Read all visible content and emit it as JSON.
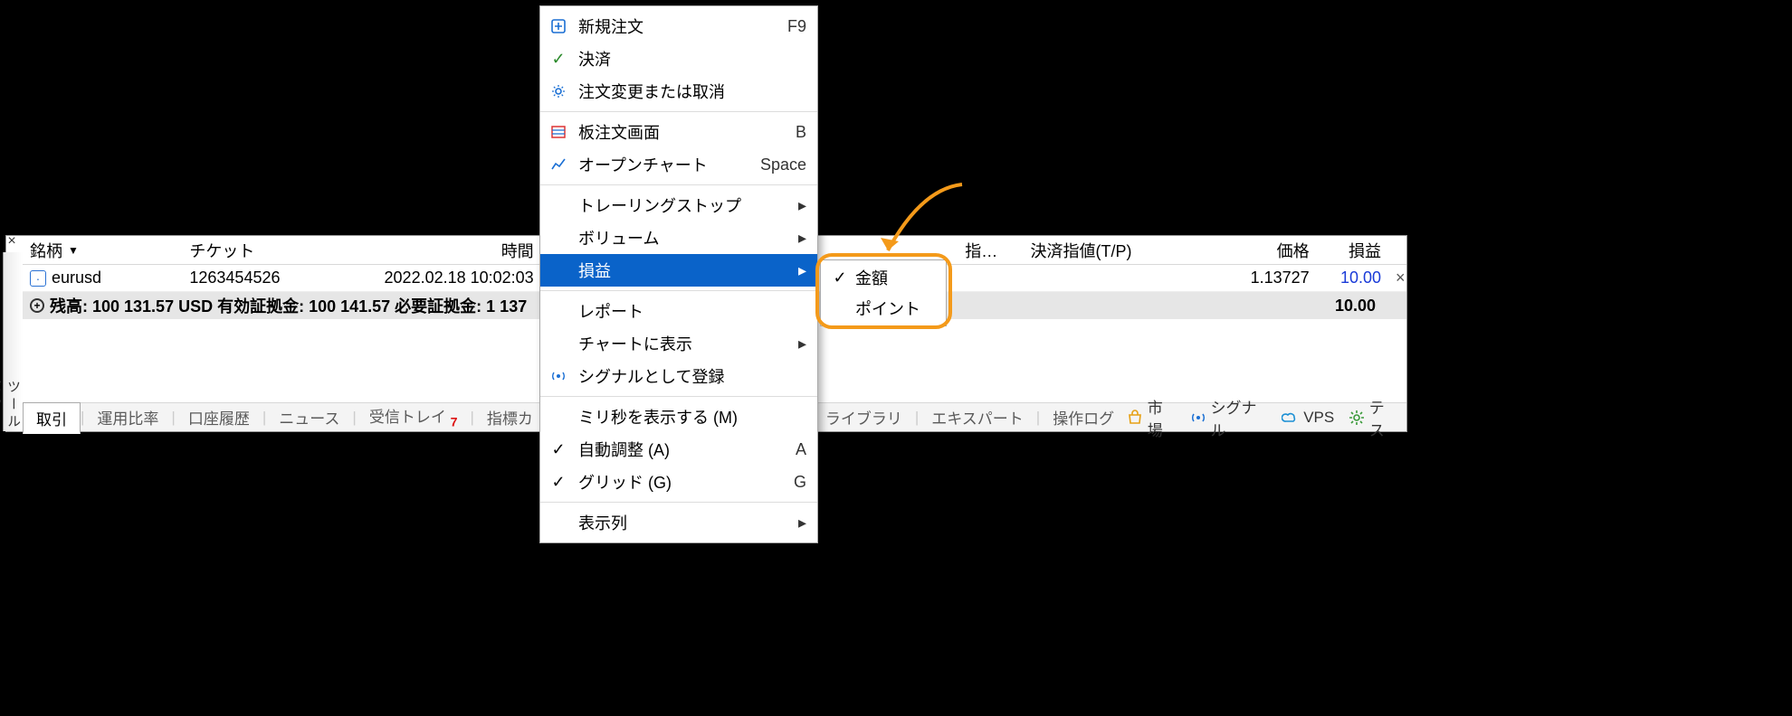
{
  "panel_title": "ツールボックス",
  "headers": {
    "symbol": "銘柄",
    "ticket": "チケット",
    "time": "時間",
    "sl_suffix": "指値(...",
    "tp": "決済指値(T/P)",
    "price": "価格",
    "pl": "損益"
  },
  "row": {
    "symbol": "eurusd",
    "ticket": "1263454526",
    "time": "2022.02.18 10:02:03",
    "price": "1.13727",
    "pl": "10.00"
  },
  "summary": {
    "text": "残高: 100 131.57 USD  有効証拠金: 100 141.57  必要証拠金: 1 137",
    "pl": "10.00"
  },
  "tabs": {
    "trade": "取引",
    "exposure": "運用比率",
    "history": "口座履歴",
    "news": "ニュース",
    "mailbox": "受信トレイ",
    "mailbox_badge": "7",
    "calendar": "指標カ",
    "library": "ライブラリ",
    "experts": "エキスパート",
    "journal": "操作ログ"
  },
  "services": {
    "market": "市場",
    "signals": "シグナル",
    "vps": "VPS",
    "tester": "テス"
  },
  "menu": {
    "new_order": {
      "label": "新規注文",
      "shortcut": "F9"
    },
    "close": {
      "label": "決済"
    },
    "modify": {
      "label": "注文変更または取消"
    },
    "depth": {
      "label": "板注文画面",
      "shortcut": "B"
    },
    "chart": {
      "label": "オープンチャート",
      "shortcut": "Space"
    },
    "trailing": {
      "label": "トレーリングストップ"
    },
    "volumes": {
      "label": "ボリューム"
    },
    "profit": {
      "label": "損益"
    },
    "report": {
      "label": "レポート"
    },
    "show_on": {
      "label": "チャートに表示"
    },
    "signal": {
      "label": "シグナルとして登録"
    },
    "ms": {
      "label": "ミリ秒を表示する (M)"
    },
    "auto": {
      "label": "自動調整 (A)",
      "shortcut": "A"
    },
    "grid": {
      "label": "グリッド (G)",
      "shortcut": "G"
    },
    "columns": {
      "label": "表示列"
    }
  },
  "submenu": {
    "money": "金額",
    "points": "ポイント"
  }
}
